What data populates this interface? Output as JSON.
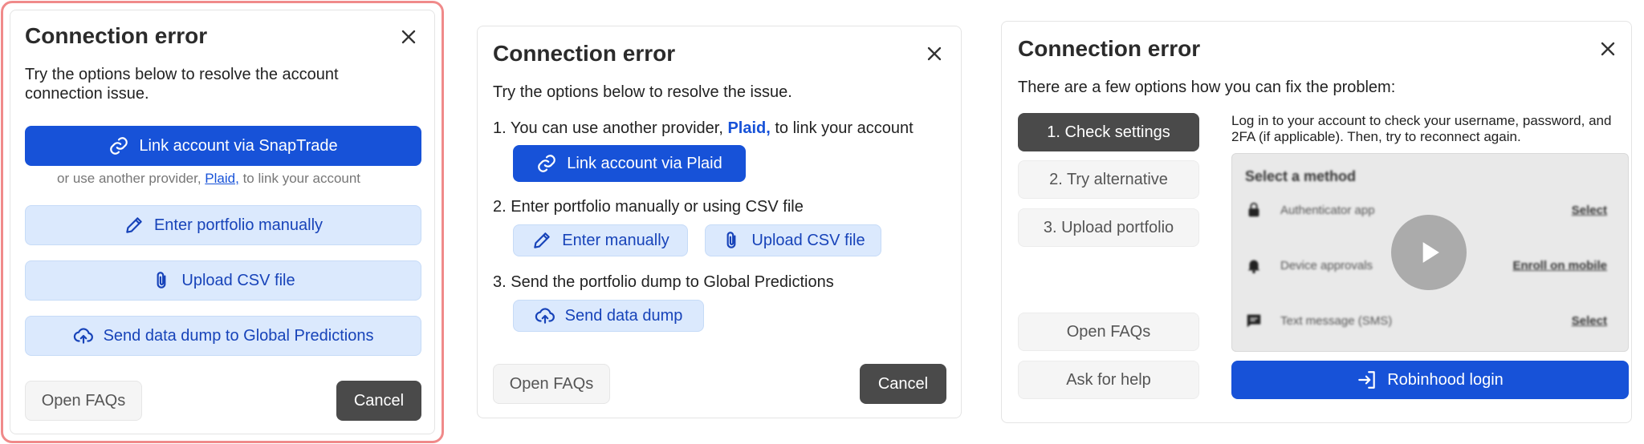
{
  "dialog1": {
    "title": "Connection error",
    "description": "Try the options below to resolve the account connection issue.",
    "primary_label": "Link account via SnapTrade",
    "note_prefix": "or use another provider,",
    "note_link": "Plaid,",
    "note_suffix": "to link your account",
    "manual_label": "Enter portfolio manually",
    "csv_label": "Upload CSV file",
    "dump_label": "Send data dump to Global Predictions",
    "faqs_label": "Open FAQs",
    "cancel_label": "Cancel"
  },
  "dialog2": {
    "title": "Connection error",
    "description": "Try the options below to resolve the issue.",
    "step1_prefix": "1.  You can use another provider,",
    "step1_link": "Plaid,",
    "step1_suffix": "to link your account",
    "plaid_label": "Link account via Plaid",
    "step2_text": "2. Enter portfolio manually or using CSV file",
    "manual_label": "Enter manually",
    "csv_label": "Upload CSV file",
    "step3_text": "3. Send the portfolio dump to Global Predictions",
    "dump_label": "Send data dump",
    "faqs_label": "Open FAQs",
    "cancel_label": "Cancel"
  },
  "dialog3": {
    "title": "Connection error",
    "description": "There are a few options how you can fix the problem:",
    "steps": [
      "1. Check settings",
      "2. Try alternative",
      "3. Upload portfolio"
    ],
    "faqs_label": "Open FAQs",
    "help_label": "Ask for help",
    "instructions": "Log in to your account to check your username, password, and 2FA (if applicable). Then, try to reconnect again.",
    "video": {
      "heading": "Select a method",
      "rows": [
        {
          "label": "Authenticator app",
          "action": "Select"
        },
        {
          "label": "Device approvals",
          "action": "Enroll on mobile"
        },
        {
          "label": "Text message (SMS)",
          "action": "Select"
        }
      ]
    },
    "login_label": "Robinhood login"
  },
  "colors": {
    "primary": "#1752d8",
    "light": "#dbe9fd",
    "dark": "#4a4a4a",
    "highlight": "#f08a8a"
  },
  "icons": [
    "close-icon",
    "link-icon",
    "pencil-icon",
    "paperclip-icon",
    "cloud-upload-icon",
    "play-icon",
    "login-icon",
    "lock-icon",
    "bell-icon",
    "message-icon"
  ]
}
